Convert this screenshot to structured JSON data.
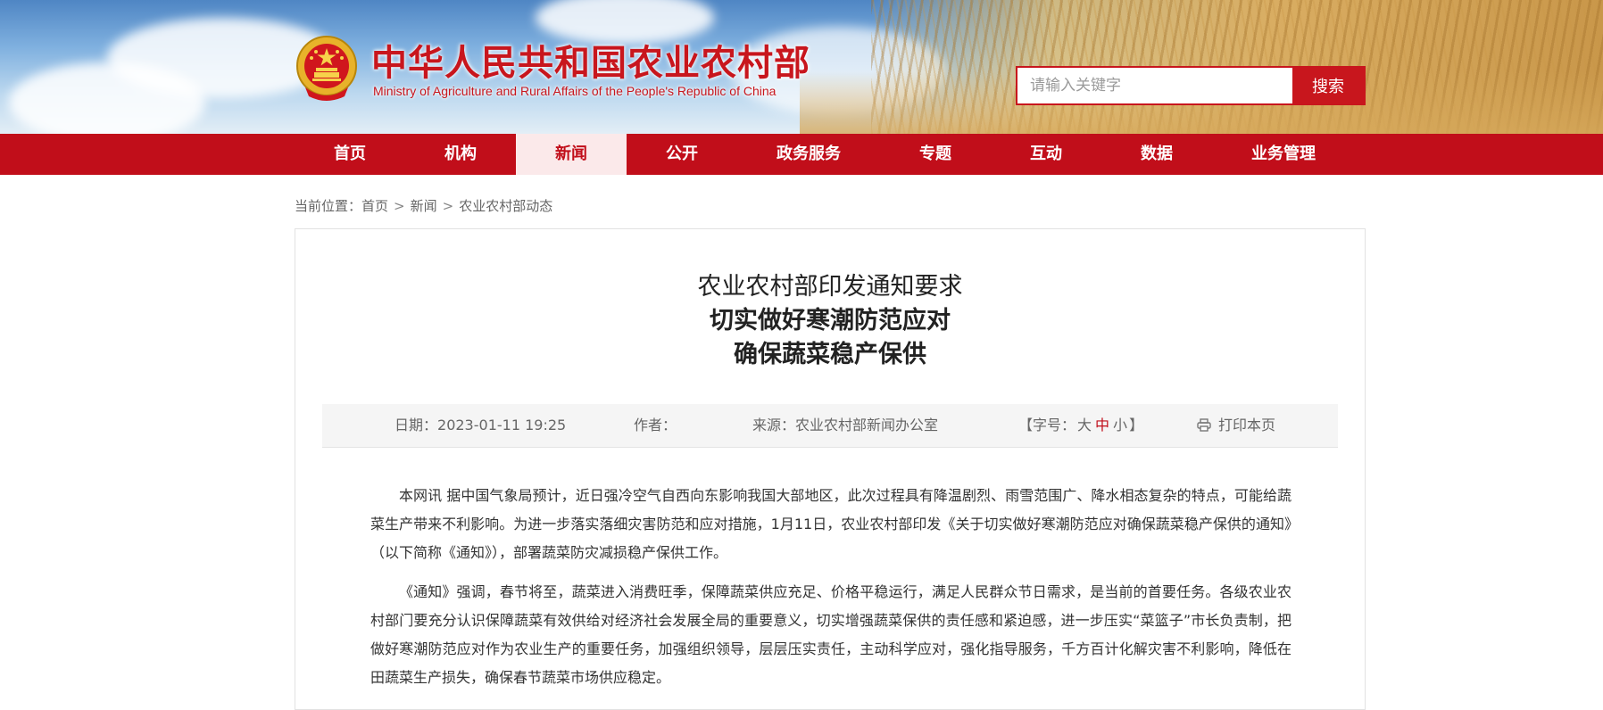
{
  "header": {
    "site_name_cn": "中华人民共和国农业农村部",
    "site_name_en": "Ministry of Agriculture and Rural Affairs of the People's Republic of China",
    "emblem_icon": "national-emblem-icon",
    "search": {
      "placeholder": "请输入关键字",
      "value": "",
      "button_label": "搜索"
    }
  },
  "nav": {
    "items": [
      {
        "label": "首页"
      },
      {
        "label": "机构"
      },
      {
        "label": "新闻",
        "active": true
      },
      {
        "label": "公开"
      },
      {
        "label": "政务服务"
      },
      {
        "label": "专题"
      },
      {
        "label": "互动"
      },
      {
        "label": "数据"
      },
      {
        "label": "业务管理"
      }
    ]
  },
  "breadcrumb": {
    "prefix": "当前位置：",
    "items": [
      "首页",
      "新闻",
      "农业农村部动态"
    ],
    "separator": ">"
  },
  "article": {
    "title_line1": "农业农村部印发通知要求",
    "title_line2": "切实做好寒潮防范应对",
    "title_line3": "确保蔬菜稳产保供",
    "meta": {
      "date_label": "日期：",
      "date_value": "2023-01-11 19:25",
      "author_label": "作者：",
      "author_value": "",
      "source_label": "来源：",
      "source_value": "农业农村部新闻办公室",
      "font_size_prefix": "【字号：",
      "font_size_options": [
        "大",
        "中",
        "小"
      ],
      "font_size_active": "中",
      "font_size_suffix": "】",
      "print_icon": "printer-icon",
      "print_label": "打印本页"
    },
    "paragraphs": [
      "本网讯 据中国气象局预计，近日强冷空气自西向东影响我国大部地区，此次过程具有降温剧烈、雨雪范围广、降水相态复杂的特点，可能给蔬菜生产带来不利影响。为进一步落实落细灾害防范和应对措施，1月11日，农业农村部印发《关于切实做好寒潮防范应对确保蔬菜稳产保供的通知》（以下简称《通知》），部署蔬菜防灾减损稳产保供工作。",
      "《通知》强调，春节将至，蔬菜进入消费旺季，保障蔬菜供应充足、价格平稳运行，满足人民群众节日需求，是当前的首要任务。各级农业农村部门要充分认识保障蔬菜有效供给对经济社会发展全局的重要意义，切实增强蔬菜保供的责任感和紧迫感，进一步压实“菜篮子”市长负责制，把做好寒潮防范应对作为农业生产的重要任务，加强组织领导，层层压实责任，主动科学应对，强化指导服务，千方百计化解灾害不利影响，降低在田蔬菜生产损失，确保春节蔬菜市场供应稳定。"
    ]
  },
  "colors": {
    "brand_red": "#c10e1a",
    "active_nav_bg": "#fbe9ea",
    "meta_bg": "#f5f5f5"
  }
}
